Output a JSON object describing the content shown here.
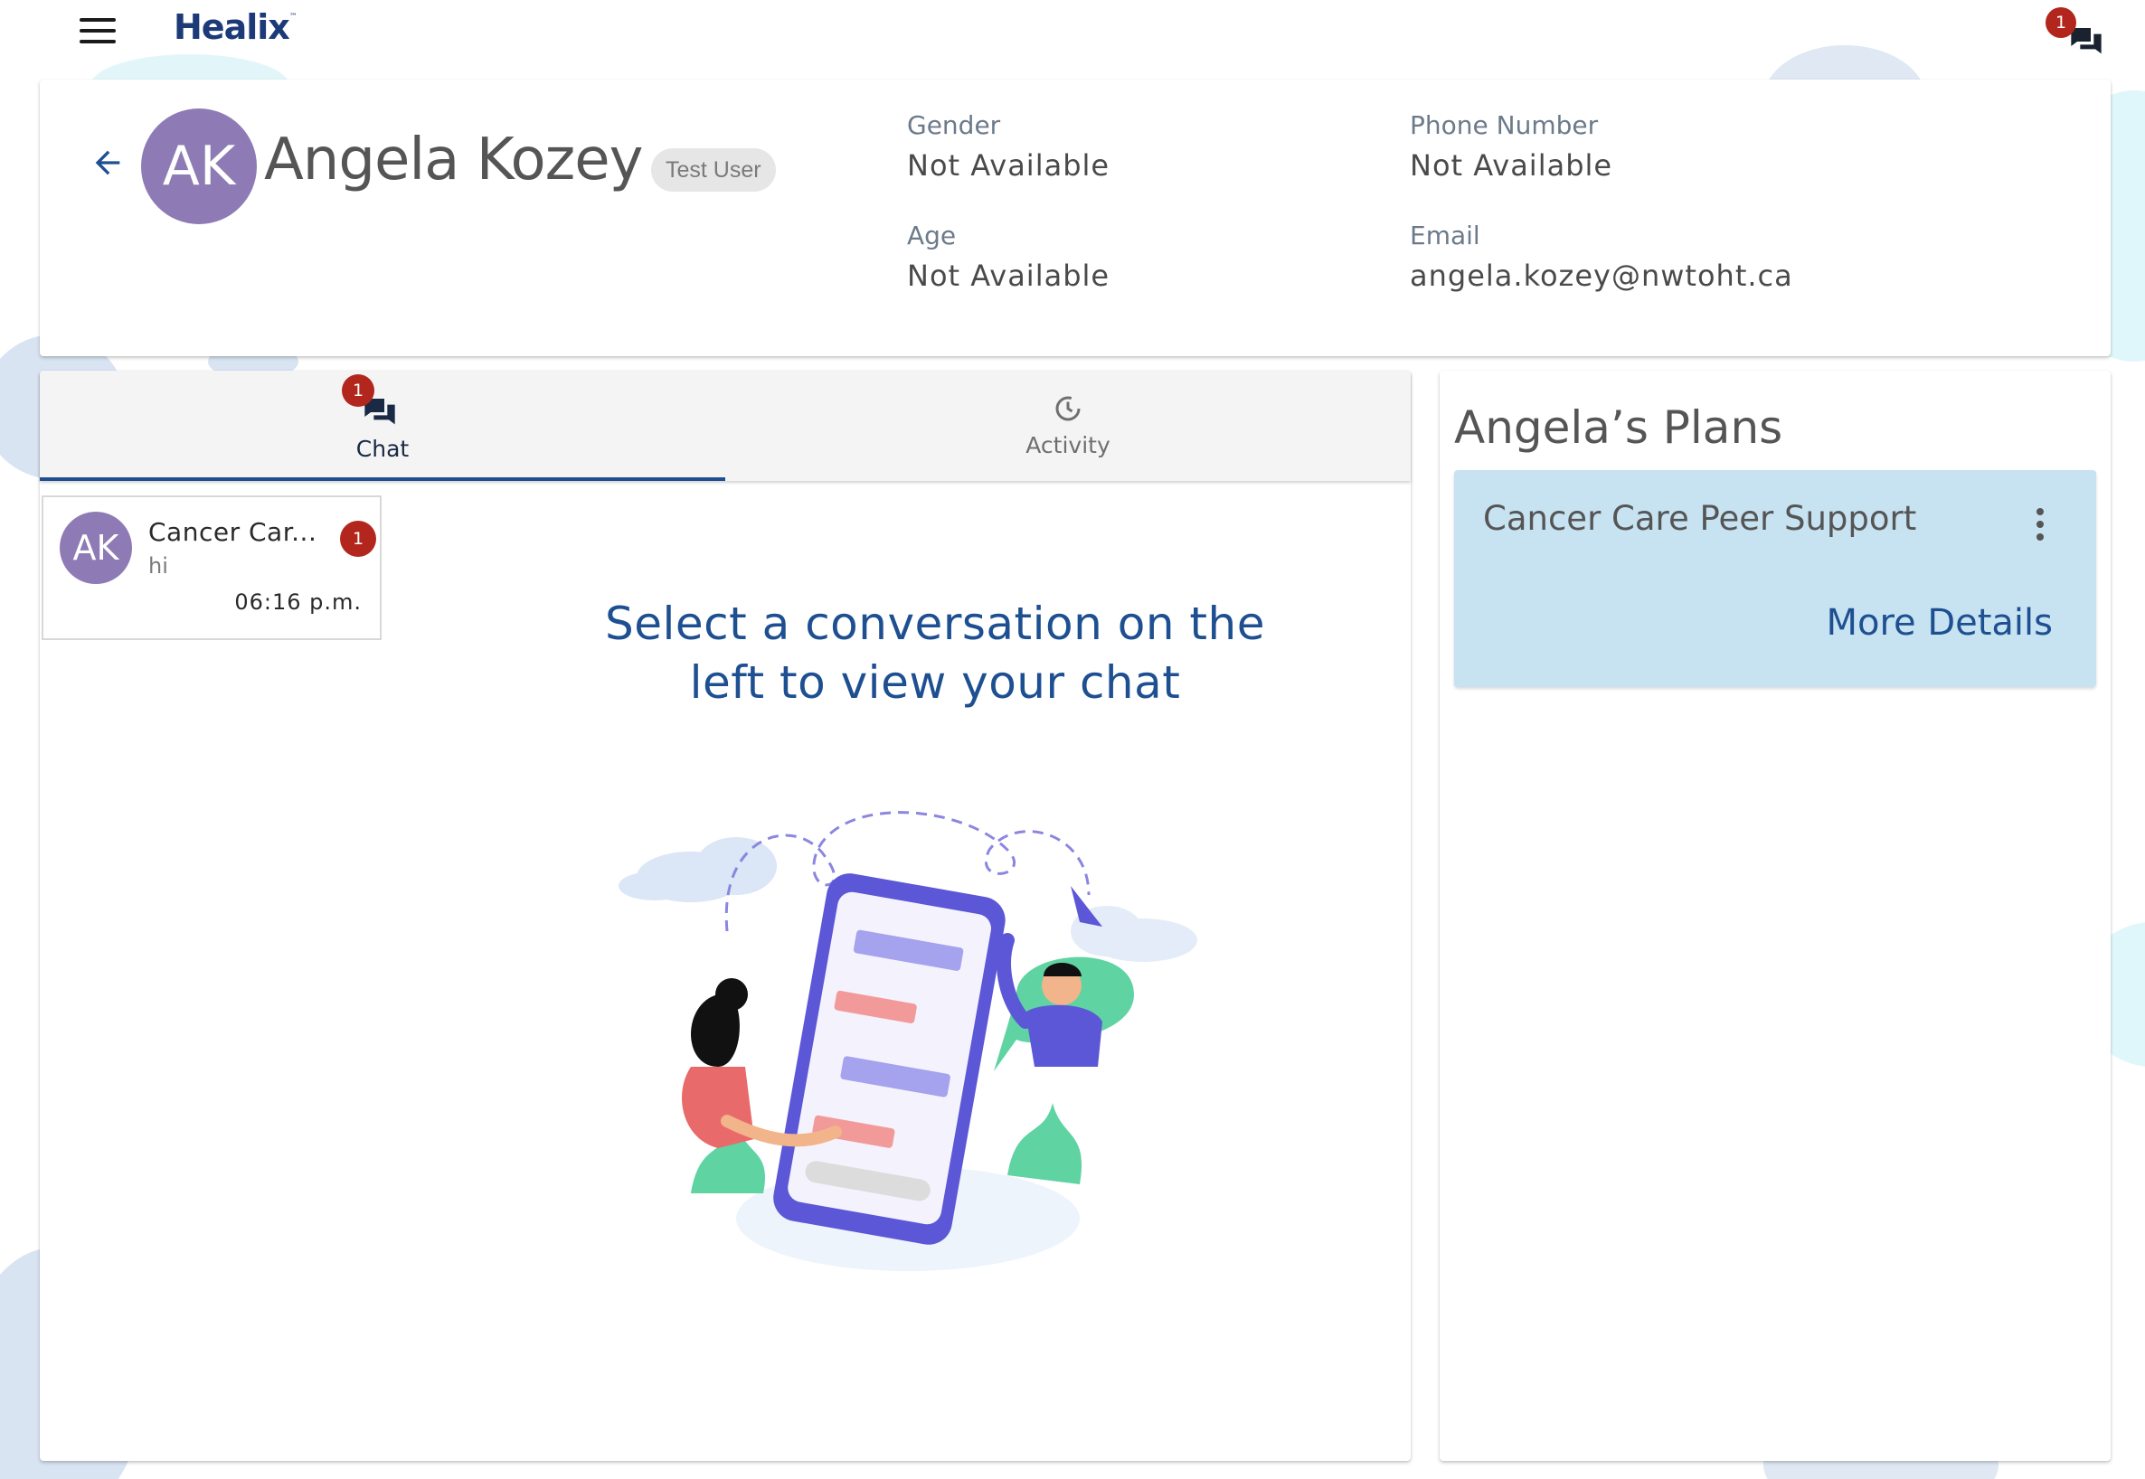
{
  "app": {
    "logo_text": "Healix",
    "logo_tm": "™",
    "chat_notification_count": "1"
  },
  "profile": {
    "initials": "AK",
    "name": "Angela Kozey",
    "tag": "Test User",
    "fields": {
      "gender_label": "Gender",
      "gender_value": "Not Available",
      "phone_label": "Phone Number",
      "phone_value": "Not Available",
      "age_label": "Age",
      "age_value": "Not Available",
      "email_label": "Email",
      "email_value": "angela.kozey@nwtoht.ca"
    }
  },
  "tabs": {
    "chat_label": "Chat",
    "chat_badge": "1",
    "activity_label": "Activity",
    "active": "Chat"
  },
  "conversation": {
    "initials": "AK",
    "name": "Cancer Car...",
    "last_message": "hi",
    "time": "06:16 p.m.",
    "unread_count": "1"
  },
  "empty_state": {
    "line1": "Select a conversation on the",
    "line2": "left to view your chat"
  },
  "plans": {
    "title": "Angela’s Plans",
    "items": [
      {
        "name": "Cancer Care Peer Support",
        "link": "More Details"
      }
    ]
  },
  "colors": {
    "brand": "#1d3a78",
    "accent": "#1d4f91",
    "badge": "#b3261e",
    "avatar": "#8e7bb5",
    "plan_card": "#c7e2f1"
  },
  "icons": {
    "menu": "menu-icon",
    "chat": "chat-bubbles-icon",
    "activity": "activity-history-icon",
    "back": "arrow-left-icon",
    "more": "more-vertical-icon"
  }
}
